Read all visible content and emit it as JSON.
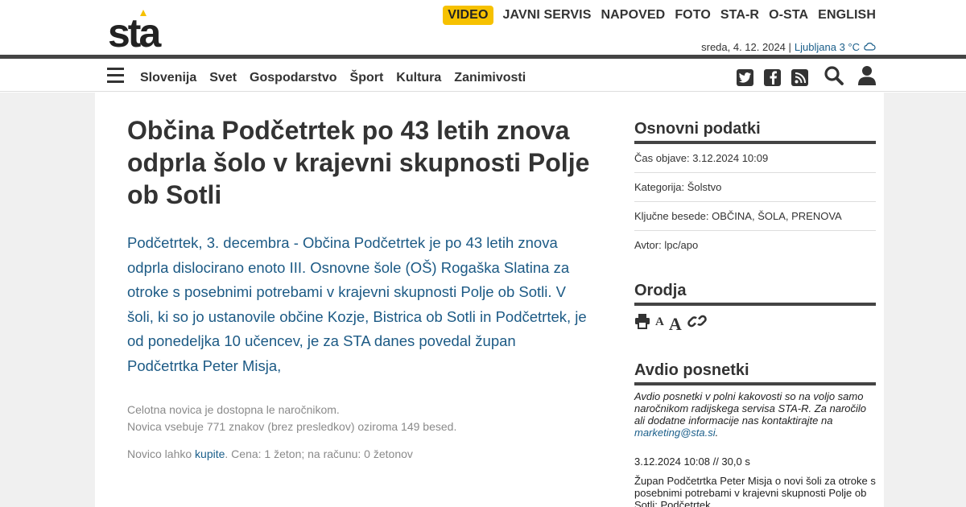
{
  "header": {
    "logo_text": "sta",
    "topnav": [
      "VIDEO",
      "JAVNI SERVIS",
      "NAPOVED",
      "FOTO",
      "STA-R",
      "O-STA",
      "ENGLISH"
    ],
    "date": "sreda, 4. 12. 2024 |",
    "weather": "Ljubljana 3 °C"
  },
  "categories": [
    "Slovenija",
    "Svet",
    "Gospodarstvo",
    "Šport",
    "Kultura",
    "Zanimivosti"
  ],
  "article": {
    "title": "Občina Podčetrtek po 43 letih znova odprla šolo v krajevni skupnosti Polje ob Sotli",
    "lead": "Podčetrtek, 3. decembra - Občina Podčetrtek je po 43 letih znova odprla dislocirano enoto III. Osnovne šole (OŠ) Rogaška Slatina za otroke s posebnimi potrebami v krajevni skupnosti Polje ob Sotli. V šoli, ki so jo ustanovile občine Kozje, Bistrica ob Sotli in Podčetrtek, je od ponedeljka 10 učencev, je za STA danes povedal župan Podčetrtka Peter Misja,",
    "note_line1": "Celotna novica je dostopna le naročnikom.",
    "note_line2": "Novica vsebuje 771 znakov (brez presledkov) oziroma 149 besed.",
    "buy_prefix": "Novico lahko ",
    "buy_link": "kupite",
    "buy_suffix": ". Cena: 1 žeton; na računu: 0 žetonov"
  },
  "sidebar": {
    "basic_title": "Osnovni podatki",
    "published": "Čas objave: 3.12.2024 10:09",
    "category": "Kategorija: Šolstvo",
    "keywords": "Ključne besede: OBČINA, ŠOLA, PRENOVA",
    "author": "Avtor: lpc/apo",
    "tools_title": "Orodja",
    "audio_title": "Avdio posnetki",
    "audio_text": "Avdio posnetki v polni kakovosti so na voljo samo naročnikom radijskega servisa STA-R. Za naročilo ali dodatne informacije nas kontaktirajte na",
    "audio_email": "marketing@sta.si",
    "audio_dot": ".",
    "clip_meta": "3.12.2024 10:08 // 30,0 s",
    "clip_desc": "Župan Podčetrtka Peter Misja o novi šoli za otroke s posebnimi potrebami v krajevni skupnosti Polje ob Sotli; Podčetrtek"
  },
  "colors": {
    "accent": "#f6c100",
    "link": "#1a5e8a",
    "lead": "#1c5a85"
  }
}
